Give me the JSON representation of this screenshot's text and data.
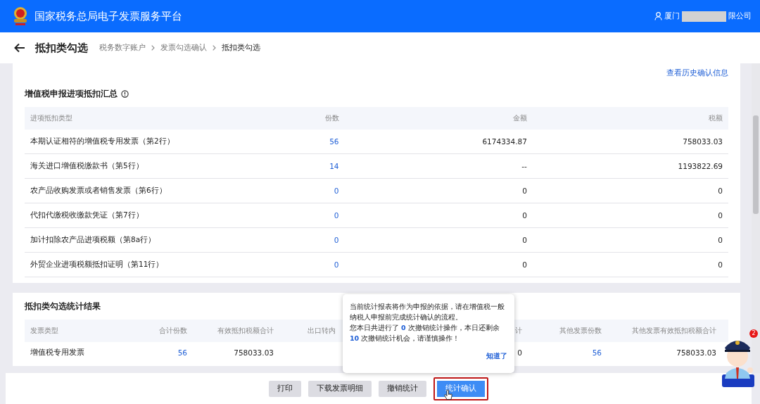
{
  "header": {
    "title": "国家税务总局电子发票服务平台",
    "user_prefix": "厦门",
    "user_suffix": "限公司"
  },
  "page": {
    "title": "抵扣类勾选",
    "breadcrumb": [
      {
        "label": "税务数字账户",
        "current": false
      },
      {
        "label": "发票勾选确认",
        "current": false
      },
      {
        "label": "抵扣类勾选",
        "current": true
      }
    ]
  },
  "history_link": "查看历史确认信息",
  "summary": {
    "title": "增值税申报进项抵扣汇总",
    "columns": [
      "进项抵扣类型",
      "份数",
      "金额",
      "税额"
    ],
    "rows": [
      [
        "本期认证相符的增值税专用发票（第2行）",
        "56",
        "6174334.87",
        "758033.03"
      ],
      [
        "海关进口增值税缴款书（第5行）",
        "14",
        "--",
        "1193822.69"
      ],
      [
        "农产品收购发票或者销售发票（第6行）",
        "0",
        "0",
        "0"
      ],
      [
        "代扣代缴税收缴款凭证（第7行）",
        "0",
        "0",
        "0"
      ],
      [
        "加计扣除农产品进项税额（第8a行）",
        "0",
        "0",
        "0"
      ],
      [
        "外贸企业进项税额抵扣证明（第11行）",
        "0",
        "0",
        "0"
      ]
    ]
  },
  "stats": {
    "title": "抵扣类勾选统计结果",
    "columns": [
      "发票类型",
      "合计份数",
      "有效抵扣税额合计",
      "出口转内",
      "计",
      "其他发票份数",
      "其他发票有效抵扣税额合计"
    ],
    "rows": [
      [
        "增值税专用发票",
        "56",
        "758033.03",
        "",
        "0",
        "56",
        "758033.03"
      ]
    ]
  },
  "popover": {
    "lines": [
      "当前统计报表将作为申报的依据，请在增值税一般纳税人申报前完成统计确认的流程。"
    ],
    "count_line": {
      "before": "您本日共进行了",
      "used": "0",
      "middle": "次撤销统计操作，本日还剩余",
      "remaining": "10",
      "after": "次撤销统计机会，请谨慎操作！"
    },
    "confirm": "知道了"
  },
  "footer_buttons": [
    {
      "label": "打印",
      "primary": false,
      "highlighted": false
    },
    {
      "label": "下载发票明细",
      "primary": false,
      "highlighted": false
    },
    {
      "label": "撤销统计",
      "primary": false,
      "highlighted": false
    },
    {
      "label": "统计确认",
      "primary": true,
      "highlighted": true
    }
  ],
  "assistant": {
    "badge": "2"
  }
}
